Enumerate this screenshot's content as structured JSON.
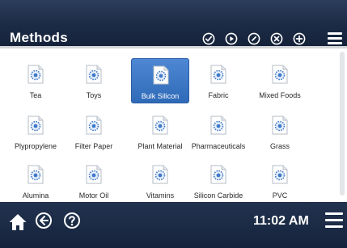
{
  "header": {
    "title": "Methods",
    "actions": [
      {
        "name": "check-circle-icon"
      },
      {
        "name": "play-circle-icon"
      },
      {
        "name": "edit-circle-icon"
      },
      {
        "name": "close-circle-icon"
      },
      {
        "name": "add-circle-icon"
      }
    ],
    "menu_icon": "menu-icon"
  },
  "methods": [
    {
      "label": "Tea",
      "selected": false
    },
    {
      "label": "Toys",
      "selected": false
    },
    {
      "label": "Bulk Silicon",
      "selected": true
    },
    {
      "label": "Fabric",
      "selected": false
    },
    {
      "label": "Mixed Foods",
      "selected": false
    },
    {
      "label": "Plypropylene",
      "selected": false
    },
    {
      "label": "Filter Paper",
      "selected": false
    },
    {
      "label": "Plant Material",
      "selected": false
    },
    {
      "label": "Pharmaceuticals",
      "selected": false
    },
    {
      "label": "Grass",
      "selected": false
    },
    {
      "label": "Alumina",
      "selected": false
    },
    {
      "label": "Motor Oil",
      "selected": false
    },
    {
      "label": "Vitamins",
      "selected": false
    },
    {
      "label": "Silicon Carbide",
      "selected": false
    },
    {
      "label": "PVC",
      "selected": false
    }
  ],
  "footer": {
    "icons": [
      "home-icon",
      "back-icon",
      "help-icon"
    ],
    "time": "11:02 AM"
  },
  "colors": {
    "header_bg": "#1c2b45",
    "selected_tile": "#3a74c2",
    "footer_bg": "#1a2840"
  }
}
